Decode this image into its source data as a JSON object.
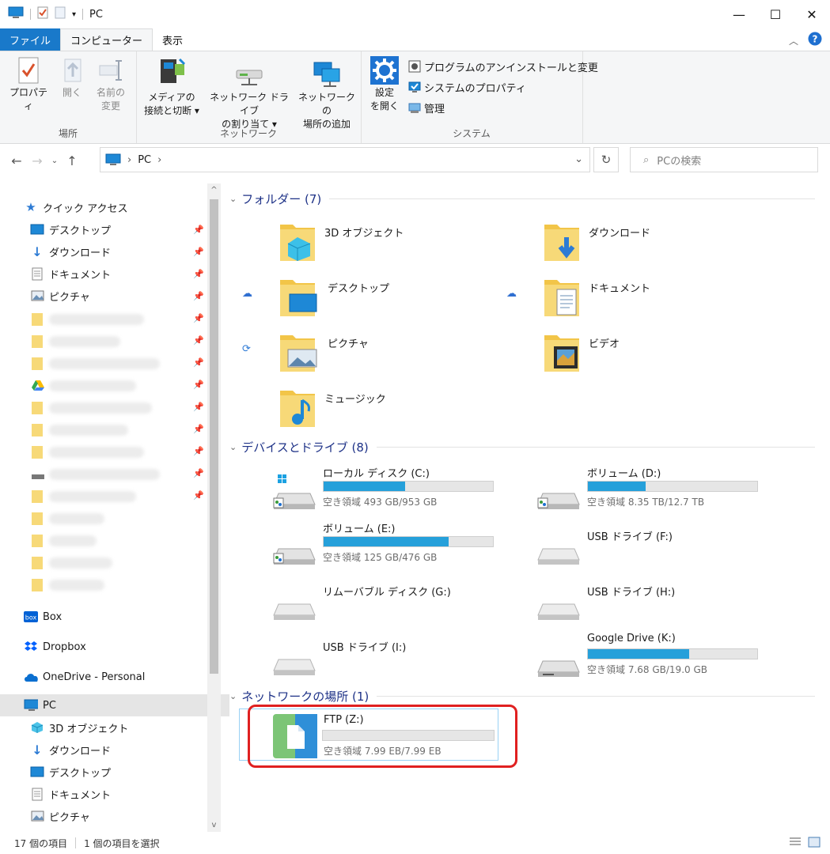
{
  "window": {
    "title": "PC"
  },
  "ribbon": {
    "tabs": [
      "ファイル",
      "コンピューター",
      "表示"
    ],
    "groups": {
      "location": {
        "label": "場所",
        "properties": "プロパティ",
        "open": "開く",
        "rename_line1": "名前の",
        "rename_line2": "変更"
      },
      "network": {
        "label": "ネットワーク",
        "media_line1": "メディアの",
        "media_line2": "接続と切断 ▾",
        "map_line1": "ネットワーク ドライブ",
        "map_line2": "の割り当て ▾",
        "add_line1": "ネットワークの",
        "add_line2": "場所の追加"
      },
      "system": {
        "label": "システム",
        "settings_line1": "設定",
        "settings_line2": "を開く",
        "uninstall": "プログラムのアンインストールと変更",
        "sysprops": "システムのプロパティ",
        "manage": "管理"
      }
    }
  },
  "address": {
    "path": "PC",
    "search_placeholder": "PCの検索"
  },
  "nav": {
    "quick_access": "クイック アクセス",
    "quick_items": [
      "デスクトップ",
      "ダウンロード",
      "ドキュメント",
      "ピクチャ"
    ],
    "box": "Box",
    "dropbox": "Dropbox",
    "onedrive": "OneDrive - Personal",
    "pc": "PC",
    "pc_items": [
      "3D オブジェクト",
      "ダウンロード",
      "デスクトップ",
      "ドキュメント",
      "ピクチャ"
    ]
  },
  "sections": {
    "folders": "フォルダー (7)",
    "devices": "デバイスとドライブ (8)",
    "network": "ネットワークの場所 (1)"
  },
  "folders": [
    "3D オブジェクト",
    "ダウンロード",
    "デスクトップ",
    "ドキュメント",
    "ピクチャ",
    "ビデオ",
    "ミュージック"
  ],
  "drives": [
    {
      "name": "ローカル ディスク (C:)",
      "free": "空き領域 493 GB/953 GB",
      "used": 0.48
    },
    {
      "name": "ボリューム (D:)",
      "free": "空き領域 8.35 TB/12.7 TB",
      "used": 0.34
    },
    {
      "name": "ボリューム (E:)",
      "free": "空き領域 125 GB/476 GB",
      "used": 0.74
    },
    {
      "name": "USB ドライブ (F:)"
    },
    {
      "name": "リムーバブル ディスク (G:)"
    },
    {
      "name": "USB ドライブ (H:)"
    },
    {
      "name": "USB ドライブ (I:)"
    },
    {
      "name": "Google Drive (K:)",
      "free": "空き領域 7.68 GB/19.0 GB",
      "used": 0.6
    }
  ],
  "network_locations": [
    {
      "name": "FTP (Z:)",
      "free": "空き領域 7.99 EB/7.99 EB",
      "used": 0.0
    }
  ],
  "status": {
    "count": "17 個の項目",
    "selected": "1 個の項目を選択"
  },
  "colors": {
    "accent": "#1979ca",
    "bar_fill": "#26a0da",
    "highlight": "#e02020"
  }
}
